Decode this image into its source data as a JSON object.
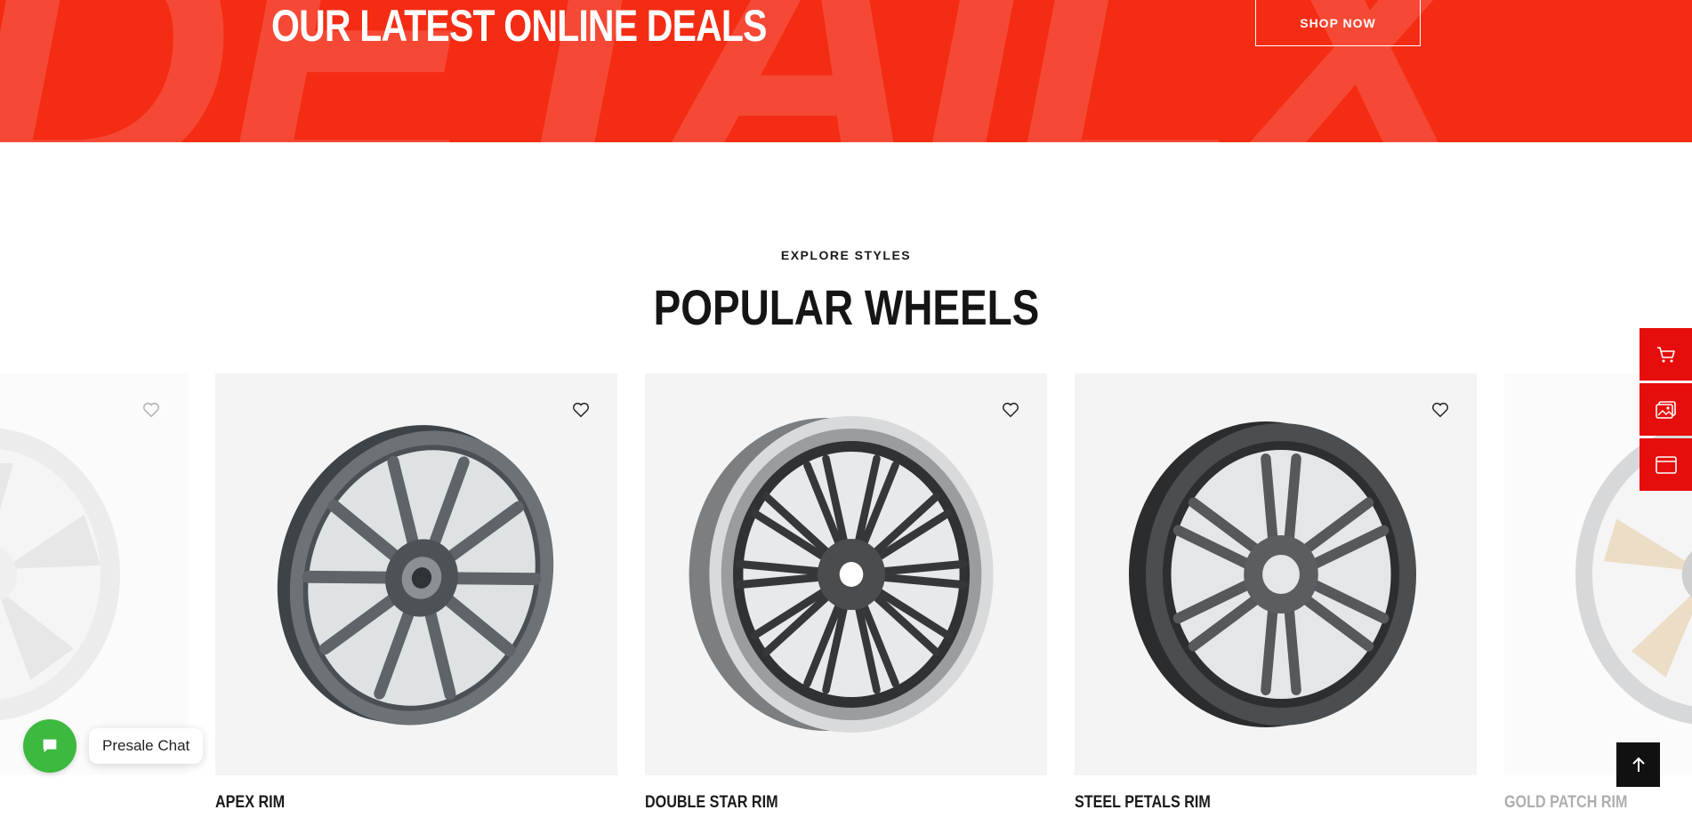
{
  "banner": {
    "title": "OUR LATEST ONLINE DEALS",
    "shop_button": "SHOP NOW",
    "background_word": "DETAILX",
    "color": "#f42c14"
  },
  "section": {
    "eyebrow": "EXPLORE STYLES",
    "heading": "POPULAR WHEELS"
  },
  "products": [
    {
      "name": "",
      "icon": "wheel-silver-image",
      "faded": true
    },
    {
      "name": "APEX RIM",
      "icon": "wheel-ten-spoke-image",
      "faded": false
    },
    {
      "name": "DOUBLE STAR RIM",
      "icon": "wheel-mesh-image",
      "faded": false
    },
    {
      "name": "STEEL PETALS RIM",
      "icon": "wheel-split-spoke-image",
      "faded": false
    },
    {
      "name": "GOLD PATCH RIM",
      "icon": "wheel-gold-image",
      "faded": true
    }
  ],
  "sidebar": {
    "items": [
      {
        "icon": "cart-icon"
      },
      {
        "icon": "gallery-icon"
      },
      {
        "icon": "browser-window-icon"
      }
    ],
    "color": "#e60d0d"
  },
  "chat": {
    "label": "Presale Chat",
    "color": "#3db93f"
  },
  "scroll_top": {
    "icon": "arrow-up-icon"
  }
}
